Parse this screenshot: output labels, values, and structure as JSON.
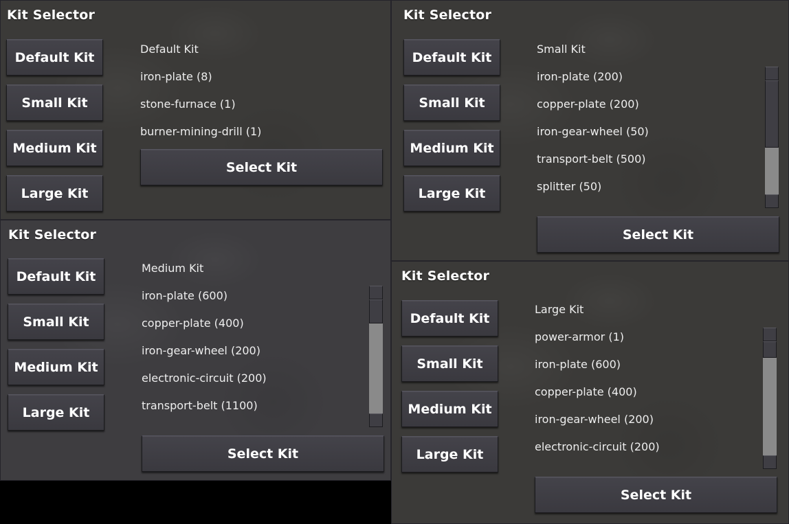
{
  "panels": [
    {
      "title": "Kit Selector",
      "buttons": [
        "Default Kit",
        "Small Kit",
        "Medium Kit",
        "Large Kit"
      ],
      "kit_name": "Default Kit",
      "items": [
        "iron-plate (8)",
        "stone-furnace (1)",
        "burner-mining-drill (1)"
      ],
      "select_label": "Select Kit"
    },
    {
      "title": "Kit Selector",
      "buttons": [
        "Default Kit",
        "Small Kit",
        "Medium Kit",
        "Large Kit"
      ],
      "kit_name": "Small Kit",
      "items": [
        "iron-plate (200)",
        "copper-plate (200)",
        "iron-gear-wheel (50)",
        "transport-belt (500)",
        "splitter (50)"
      ],
      "select_label": "Select Kit"
    },
    {
      "title": "Kit Selector",
      "buttons": [
        "Default Kit",
        "Small Kit",
        "Medium Kit",
        "Large Kit"
      ],
      "kit_name": "Medium Kit",
      "items": [
        "iron-plate (600)",
        "copper-plate (400)",
        "iron-gear-wheel (200)",
        "electronic-circuit (200)",
        "transport-belt (1100)"
      ],
      "select_label": "Select Kit"
    },
    {
      "title": "Kit Selector",
      "buttons": [
        "Default Kit",
        "Small Kit",
        "Medium Kit",
        "Large Kit"
      ],
      "kit_name": "Large Kit",
      "items": [
        "power-armor (1)",
        "iron-plate (600)",
        "copper-plate (400)",
        "iron-gear-wheel (200)",
        "electronic-circuit (200)"
      ],
      "select_label": "Select Kit"
    }
  ]
}
